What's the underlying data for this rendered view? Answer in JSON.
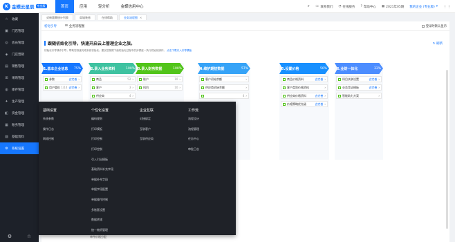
{
  "topbar": {
    "logo_mark": "K",
    "logo_text": "金蝶云星辰",
    "logo_badge": "专业版",
    "nav": [
      {
        "label": "首页",
        "active": true
      },
      {
        "label": "应用",
        "active": false
      },
      {
        "label": "轻分析",
        "active": false
      },
      {
        "label": "金蝶信用中心",
        "active": false
      }
    ],
    "right": {
      "search_icon": "search-icon",
      "contact": "联系我们",
      "online_service": "在线服务",
      "help": "帮助中心",
      "date": "2021年05期",
      "user": "我的企业 (专业版)",
      "grid_icon": "grid-icon"
    }
  },
  "sidebar": {
    "items": [
      {
        "label": "收藏",
        "icon": "star-icon",
        "glyph": "☆"
      },
      {
        "label": "门店管理",
        "icon": "store-icon",
        "glyph": "▣"
      },
      {
        "label": "会员管理",
        "icon": "member-icon",
        "glyph": "◎"
      },
      {
        "label": "门店营销",
        "icon": "marketing-icon",
        "glyph": "◈"
      },
      {
        "label": "销售管理",
        "icon": "sales-icon",
        "glyph": "▤"
      },
      {
        "label": "采购管理",
        "icon": "purchase-icon",
        "glyph": "⊞"
      },
      {
        "label": "库存管理",
        "icon": "inventory-icon",
        "glyph": "◍"
      },
      {
        "label": "生产管理",
        "icon": "production-icon",
        "glyph": "✦"
      },
      {
        "label": "资金管理",
        "icon": "fund-icon",
        "glyph": "◧"
      },
      {
        "label": "账务管理",
        "icon": "accounting-icon",
        "glyph": "▦"
      },
      {
        "label": "基础资料",
        "icon": "basic-data-icon",
        "glyph": "▨"
      },
      {
        "label": "系统设置",
        "icon": "settings-icon",
        "glyph": "⚙"
      }
    ],
    "active_index": 11,
    "bottom": [
      "⚙",
      "☆"
    ]
  },
  "tabs": [
    {
      "label": "对新版需统计列表",
      "active": false
    },
    {
      "label": "商城装修",
      "active": false
    },
    {
      "label": "在线帮助",
      "active": false
    },
    {
      "label": "业务流程图",
      "active": true
    }
  ],
  "content": {
    "subtabs": [
      {
        "label": "初化引导",
        "active": true
      },
      {
        "label": "业务流程图",
        "active": false
      }
    ],
    "show_login": "登录时默认显示",
    "guide_title": "跟随初始化引导，快速开启云上管理企业之旅。",
    "guide_desc": "初始化引导操作引导，帮助您快速完成系统初始化。建议您按照下面初始化过程中的步骤逐一执行初始化操作。",
    "guide_link": "点击下载引入引导模板",
    "refresh": "刷新"
  },
  "steps": [
    {
      "title": "1.基本企业信息",
      "pct": "75%",
      "color": "#1677ff",
      "rows": [
        {
          "label": "参数",
          "num": "",
          "action": "去完善"
        },
        {
          "label": "用户管理",
          "num": "1/14",
          "action": "去完善"
        }
      ]
    },
    {
      "title": "2.录入业务资料",
      "pct": "100%",
      "color": "#3ec2a0",
      "rows": [
        {
          "label": "商品",
          "num": "52",
          "action": ""
        },
        {
          "label": "客户",
          "num": "3",
          "action": ""
        },
        {
          "label": "供应商",
          "num": "4",
          "action": ""
        }
      ]
    },
    {
      "title": "3.录入财务数据",
      "pct": "100%",
      "color": "#52c41a",
      "rows": [
        {
          "label": "账户",
          "num": "10",
          "action": ""
        },
        {
          "label": "科目",
          "num": "10",
          "action": ""
        }
      ]
    },
    {
      "title": "4.维护期初数据",
      "pct": "57%",
      "color": "#36a3f7",
      "rows": [
        {
          "label": "客户初始余额",
          "num": "",
          "action": ""
        },
        {
          "label": "供应商初始余额",
          "num": "",
          "action": ""
        },
        {
          "label": "",
          "num": "4",
          "action": ""
        }
      ]
    },
    {
      "title": "5.设置价格",
      "pct": "50%",
      "color": "#1890ff",
      "rows": [
        {
          "label": "商品价格资料",
          "num": "",
          "action": "去完善"
        },
        {
          "label": "客户类别价格资料",
          "num": "",
          "action": ""
        },
        {
          "label": "供应商价格资料",
          "num": "",
          "action": "去完善"
        },
        {
          "label": "价格策略优先级",
          "num": "",
          "action": "去完善"
        }
      ]
    },
    {
      "title": "6.业财一体化",
      "pct": "33%",
      "color": "#4c8dff",
      "rows": [
        {
          "label": "科目关联设置",
          "num": "",
          "action": "去完善"
        },
        {
          "label": "业务凭证模板",
          "num": "",
          "action": "去完善"
        },
        {
          "label": "智能助力方案",
          "num": "",
          "action": ""
        }
      ]
    }
  ],
  "popup_menu": {
    "columns": [
      {
        "title": "基础设置",
        "items": [
          "系统参数",
          "操作日志",
          "网络控制"
        ]
      },
      {
        "title": "个性化设置",
        "items": [
          "编码规则",
          "打印模板",
          "打印控制",
          "打印控制",
          "引入引出模板",
          "基础资料补充字段",
          "单据补充字段",
          "单据字段配置",
          "单据操作控制",
          "多账套设置",
          "数据转储",
          "统一物资管理"
        ]
      },
      {
        "title": "企业互联",
        "items": [
          "对接绑定",
          "互联客户",
          "互联供应商"
        ]
      },
      {
        "title": "工作流",
        "items": [
          "流程设计",
          "流程管理",
          "任务中心",
          "审批日志"
        ]
      }
    ]
  },
  "bottom_peek": "单件价格分配"
}
